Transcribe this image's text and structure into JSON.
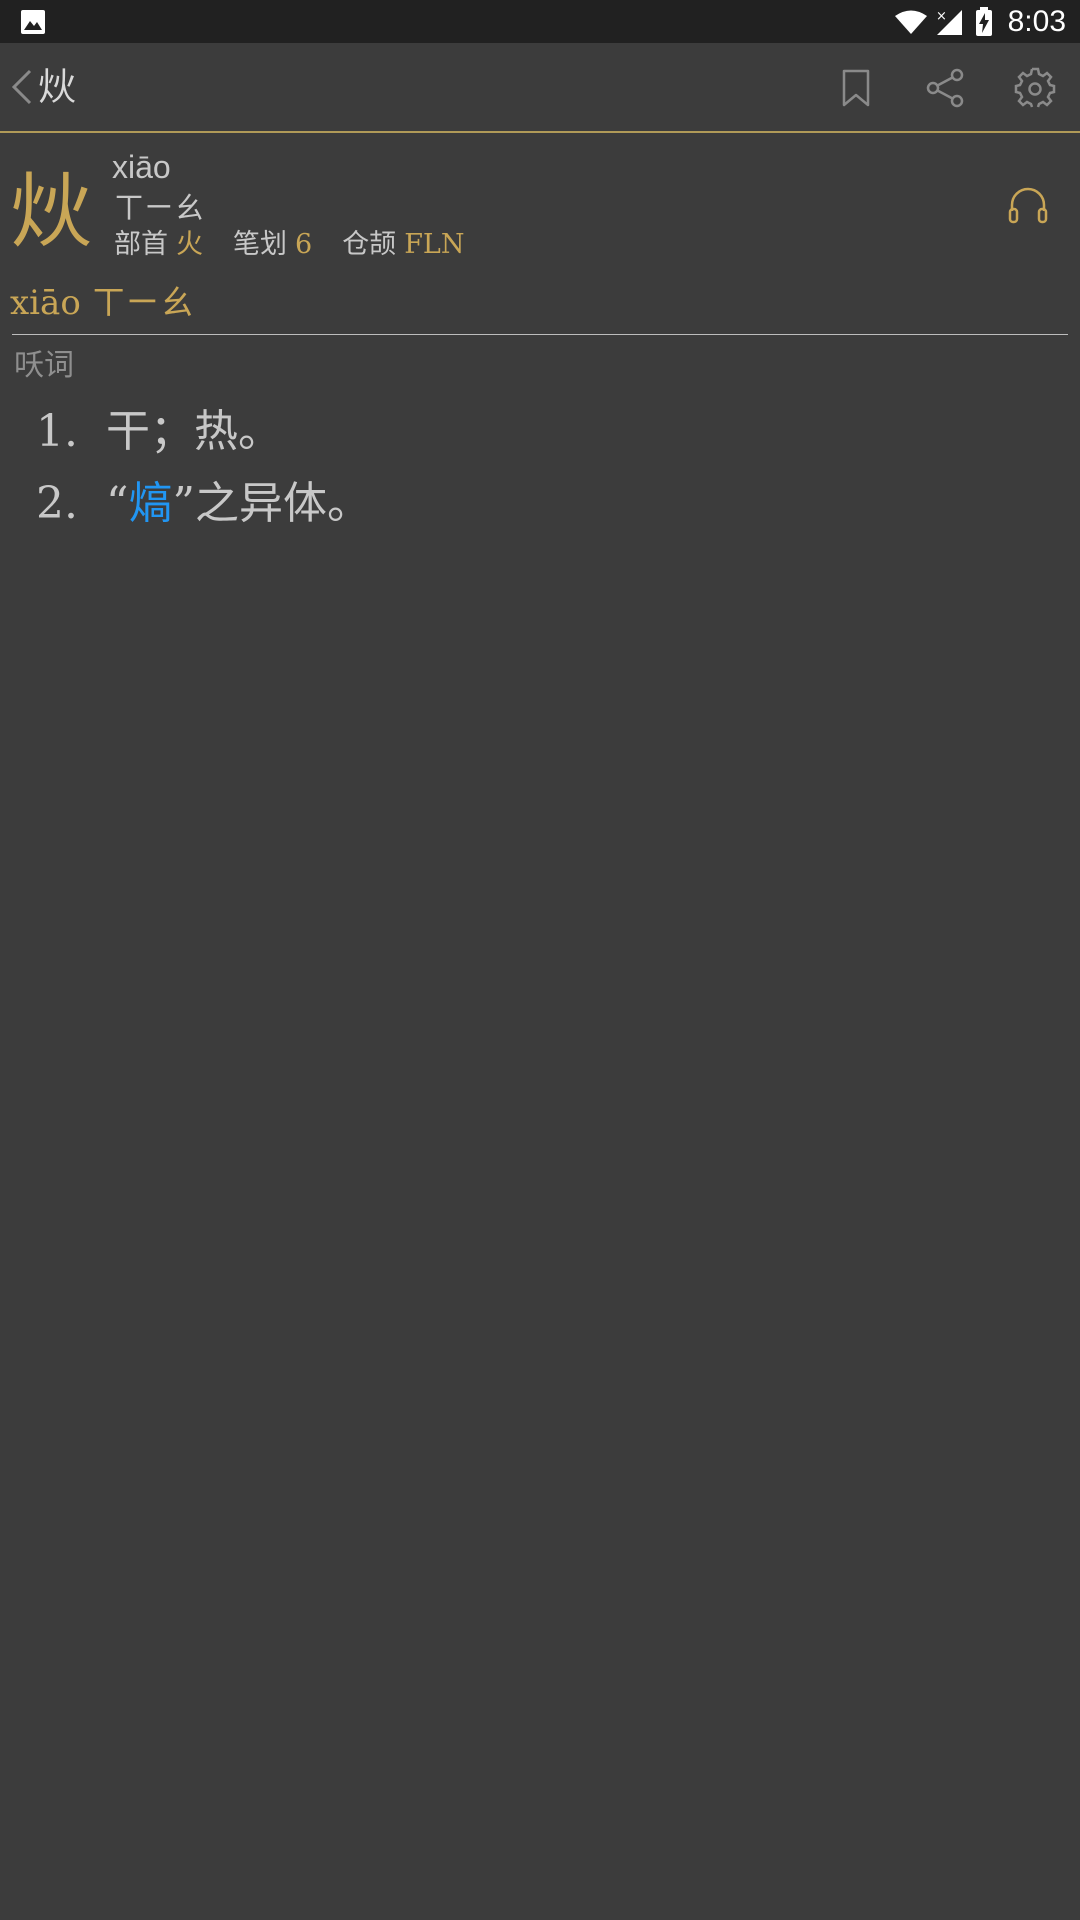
{
  "status_bar": {
    "time": "8:03"
  },
  "toolbar": {
    "title": "炏"
  },
  "entry": {
    "character": "炏",
    "pinyin": "xiāo",
    "zhuyin": "ㄒㄧㄠ",
    "radical_label": "部首",
    "radical_value": "火",
    "strokes_label": "笔划",
    "strokes_value": "6",
    "cangjie_label": "仓颉",
    "cangjie_value": "FLN",
    "reading": "xiāo ㄒㄧㄠ"
  },
  "definitions": {
    "pos": "㕭词",
    "items": [
      {
        "num": "1.",
        "text": "干；热。"
      },
      {
        "num": "2.",
        "pre": "“",
        "link": "熇",
        "post": "”之异体。"
      }
    ]
  },
  "colors": {
    "accent": "#c9a656",
    "link": "#2196f3",
    "background": "#3c3c3c"
  }
}
